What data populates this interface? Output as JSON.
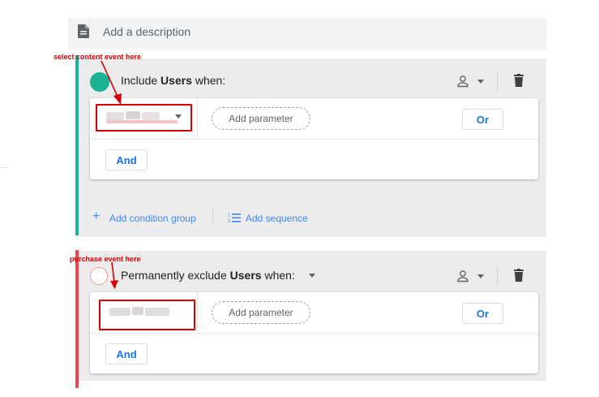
{
  "description": {
    "placeholder": "Add a description",
    "icon": "document-icon"
  },
  "annotations": {
    "first": "select content event here",
    "second": "purchase event here",
    "color": "#d50000"
  },
  "group1": {
    "prefix": "Include ",
    "subject": "Users",
    "suffix": " when:",
    "accent": "#1ab394",
    "condition": {
      "add_parameter_label": "Add parameter",
      "or_label": "Or"
    },
    "and_label": "And",
    "add_condition_group_label": "Add condition group",
    "add_sequence_label": "Add sequence"
  },
  "group2": {
    "prefix": "Permanently exclude ",
    "subject": "Users",
    "suffix": " when:",
    "accent": "#e8454d",
    "condition": {
      "add_parameter_label": "Add parameter",
      "or_label": "Or"
    },
    "and_label": "And"
  },
  "colors": {
    "link_blue": "#1a73e8",
    "panel_bg": "#ececec"
  }
}
